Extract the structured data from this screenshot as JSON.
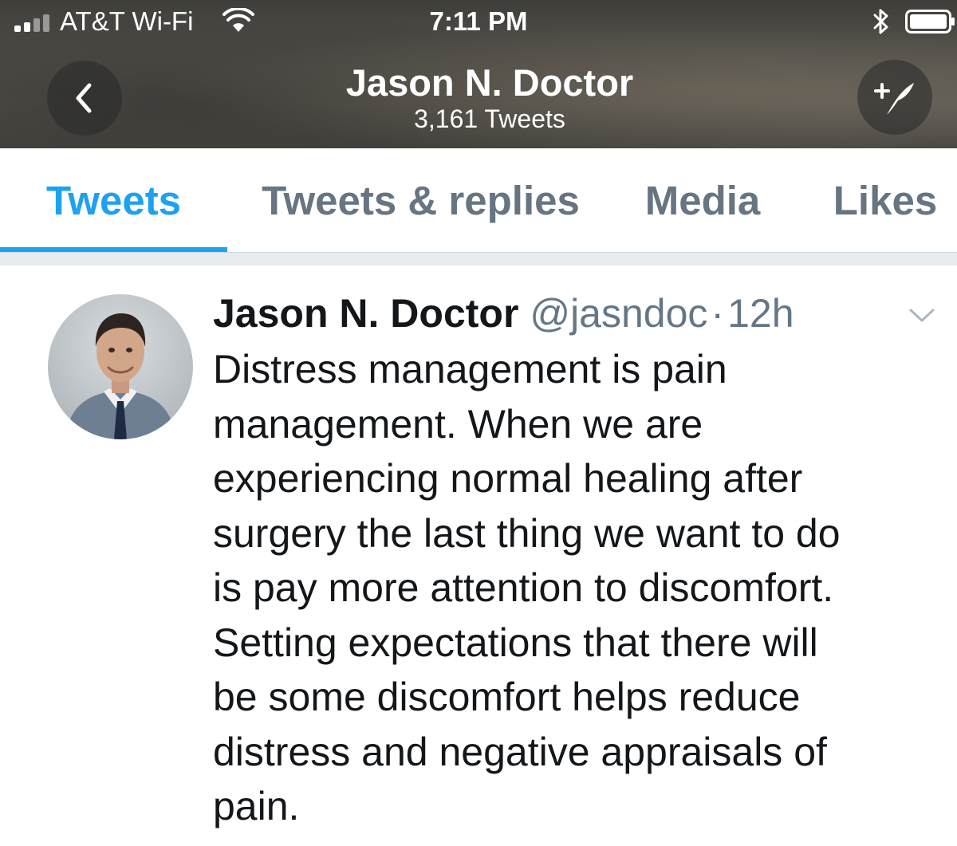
{
  "status_bar": {
    "carrier": "AT&T Wi-Fi",
    "time": "7:11 PM",
    "icons": [
      "signal-icon",
      "wifi-icon",
      "bluetooth-icon",
      "battery-icon"
    ]
  },
  "header": {
    "back_icon": "chevron-left-icon",
    "title": "Jason N. Doctor",
    "tweet_count": "3,161 Tweets",
    "compose_icon": "compose-tweet-icon"
  },
  "tabs": [
    {
      "label": "Tweets",
      "active": true
    },
    {
      "label": "Tweets & replies",
      "active": false
    },
    {
      "label": "Media",
      "active": false
    },
    {
      "label": "Likes",
      "active": false
    }
  ],
  "tweet": {
    "author_name": "Jason N. Doctor",
    "handle": "@jasndoc",
    "separator": "·",
    "time": "12h",
    "menu_icon": "chevron-down-icon",
    "text_lines": [
      "Distress management is pain",
      "management. When we are",
      "experiencing normal healing after",
      "surgery the last thing we want to do",
      "is pay more attention to discomfort.",
      "Setting expectations that there will",
      "be some discomfort helps reduce",
      "distress and negative appraisals of",
      "pain."
    ]
  },
  "colors": {
    "accent": "#1da1f2",
    "tab_inactive": "#667581",
    "text_primary": "#14171a",
    "text_secondary": "#657786",
    "divider": "#e6ecf0"
  }
}
